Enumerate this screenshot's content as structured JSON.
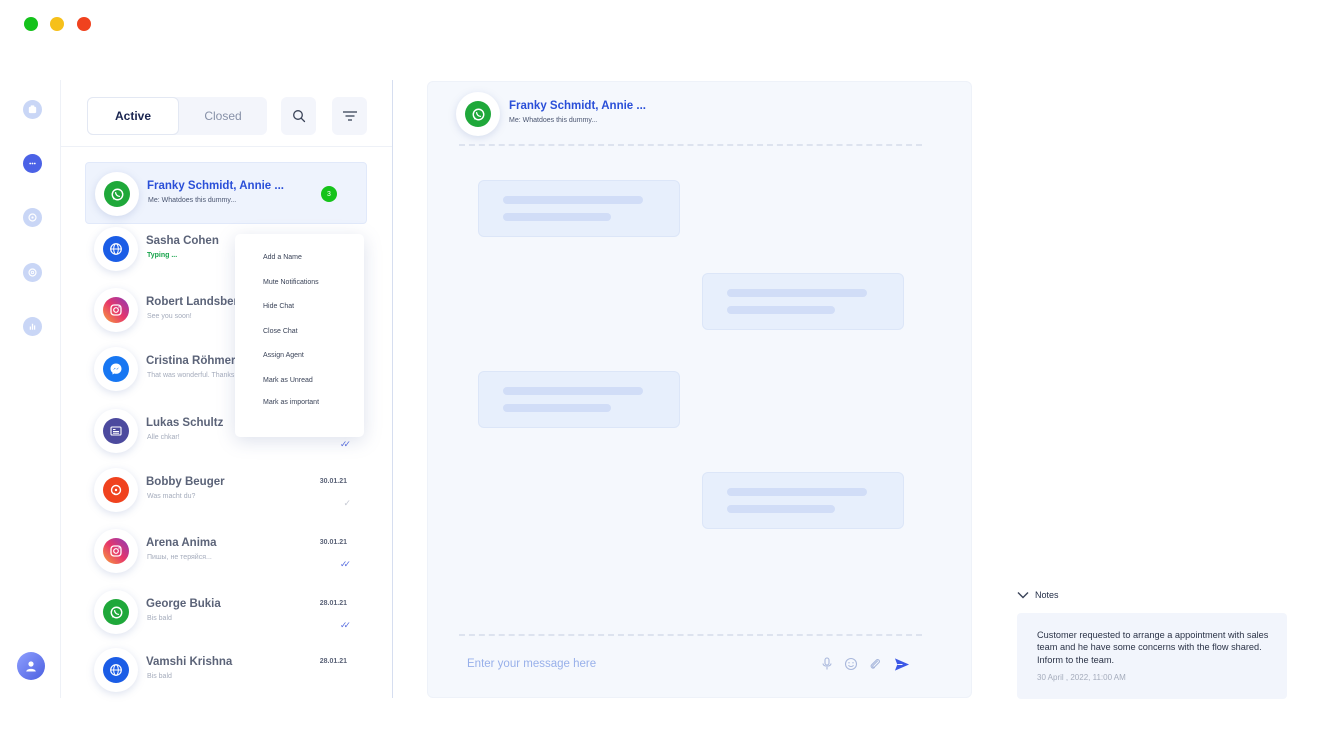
{
  "window": {
    "controls": [
      "close",
      "minimize",
      "maximize"
    ]
  },
  "rail": {
    "icons": [
      "inbox-icon",
      "chat-icon",
      "whatsapp-icon",
      "settings-icon",
      "analytics-icon"
    ],
    "active": "chat-icon"
  },
  "tabs": {
    "active_label": "Active",
    "closed_label": "Closed"
  },
  "colors": {
    "accent": "#2a4fd8",
    "whatsapp": "#1fa83a",
    "web": "#1b5de6",
    "messenger": "#1877f2",
    "instagram": "#d62976",
    "badge": "#16c31b"
  },
  "chats": [
    {
      "name": "Franky Schmidt, Annie ...",
      "preview": "Me: Whatdoes this dummy...",
      "channel": "whatsapp",
      "date": "",
      "badge": "3",
      "status": "",
      "selected": true
    },
    {
      "name": "Sasha Cohen",
      "preview": "Typing ...",
      "channel": "web",
      "date": "",
      "badge": "",
      "status": "",
      "typing": true
    },
    {
      "name": "Robert Landsberger",
      "preview": "See you soon!",
      "channel": "instagram",
      "date": "",
      "badge": "",
      "status": ""
    },
    {
      "name": "Cristina Röhmer",
      "preview": "That was wonderful. Thanks",
      "channel": "messenger",
      "date": "",
      "badge": "",
      "status": ""
    },
    {
      "name": "Lukas Schultz",
      "preview": "Alle chkar!",
      "channel": "form",
      "date": "",
      "badge": "",
      "status": "read"
    },
    {
      "name": "Bobby Beuger",
      "preview": "Was macht du?",
      "channel": "chat",
      "date": "30.01.21",
      "badge": "",
      "status": "sent"
    },
    {
      "name": "Arena Anima",
      "preview": "Пишы, не теряйся...",
      "channel": "instagram",
      "date": "30.01.21",
      "badge": "",
      "status": "read"
    },
    {
      "name": "George Bukia",
      "preview": "Bis bald",
      "channel": "whatsapp",
      "date": "28.01.21",
      "badge": "",
      "status": "read"
    },
    {
      "name": "Vamshi Krishna",
      "preview": "Bis bald",
      "channel": "web",
      "date": "28.01.21",
      "badge": "",
      "status": ""
    }
  ],
  "context_menu": [
    "Add a Name",
    "Mute Notifications",
    "Hide Chat",
    "Close Chat",
    "Assign Agent",
    "Mark as Unread",
    "Mark as important"
  ],
  "conversation": {
    "name": "Franky Schmidt, Annie ...",
    "preview": "Me: Whatdoes this dummy...",
    "input_placeholder": "Enter your message here"
  },
  "notes": {
    "heading": "Notes",
    "text": "Customer requested to arrange a appointment with sales team and he have some concerns with the flow shared. Inform to the team.",
    "timestamp": "30 April , 2022, 11:00 AM"
  }
}
